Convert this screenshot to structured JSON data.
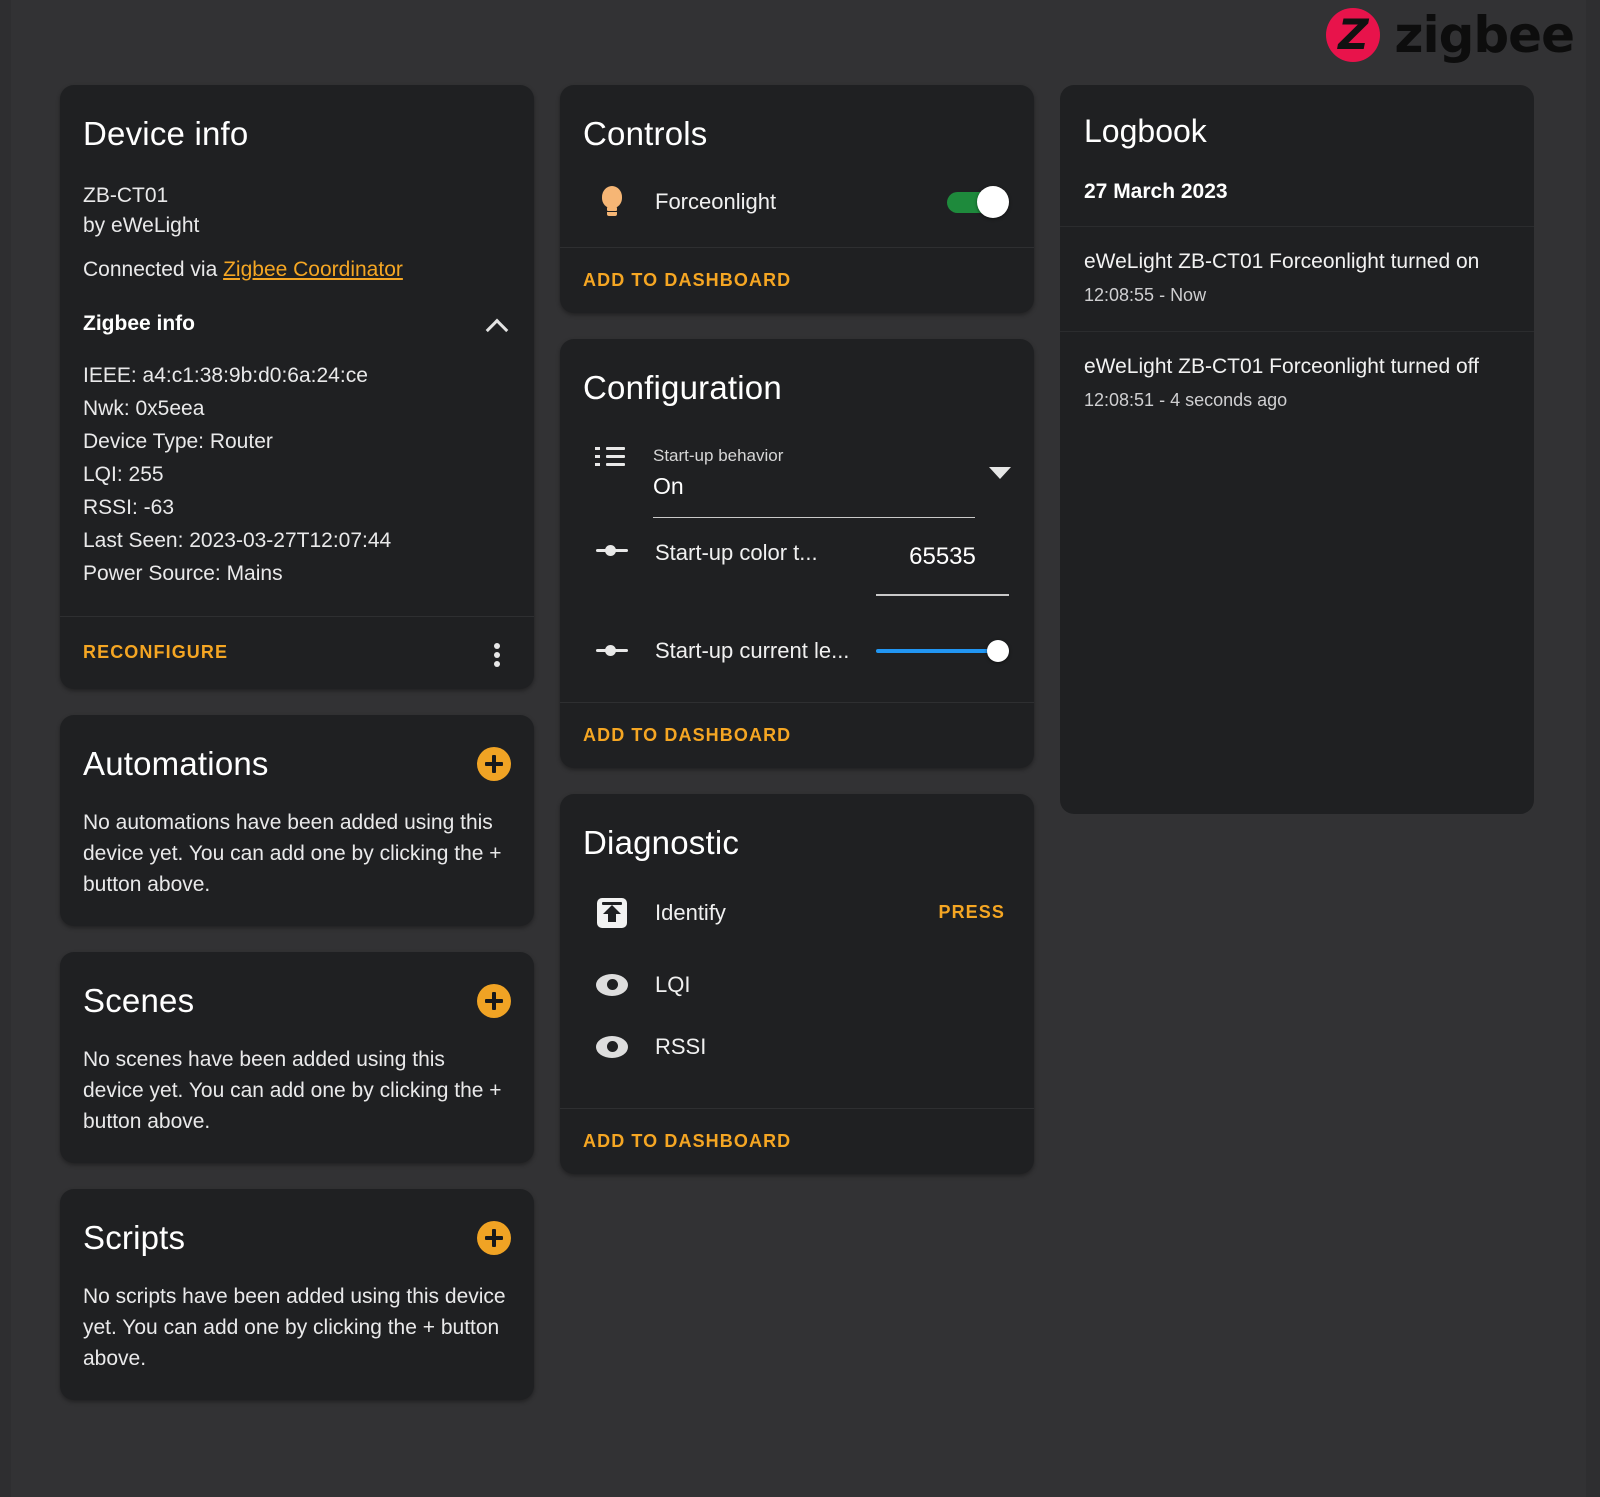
{
  "logo": {
    "mark_letter": "Z",
    "text": "zigbee",
    "mark_color": "#e8134b"
  },
  "device_info": {
    "title": "Device info",
    "model": "ZB-CT01",
    "manufacturer": "by eWeLight",
    "connected_prefix": "Connected via ",
    "connected_link": "Zigbee Coordinator",
    "zigbee_info_label": "Zigbee info",
    "zigbee_details": [
      "IEEE: a4:c1:38:9b:d0:6a:24:ce",
      "Nwk: 0x5eea",
      "Device Type: Router",
      "LQI: 255",
      "RSSI: -63",
      "Last Seen: 2023-03-27T12:07:44",
      "Power Source: Mains"
    ],
    "reconfigure_label": "RECONFIGURE"
  },
  "automations": {
    "title": "Automations",
    "empty_text": "No automations have been added using this device yet. You can add one by clicking the + button above."
  },
  "scenes": {
    "title": "Scenes",
    "empty_text": "No scenes have been added using this device yet. You can add one by clicking the + button above."
  },
  "scripts": {
    "title": "Scripts",
    "empty_text": "No scripts have been added using this device yet. You can add one by clicking the + button above."
  },
  "controls": {
    "title": "Controls",
    "entity_label": "Forceonlight",
    "toggle_state": "on",
    "toggle_color": "#1e8a3c",
    "add_to_dashboard": "ADD TO DASHBOARD"
  },
  "configuration": {
    "title": "Configuration",
    "startup_behavior_label": "Start-up behavior",
    "startup_behavior_value": "On",
    "startup_color_label": "Start-up color t...",
    "startup_color_value": "65535",
    "startup_level_label": "Start-up current le...",
    "startup_level_percent": 100,
    "slider_color": "#2196f3",
    "add_to_dashboard": "ADD TO DASHBOARD"
  },
  "diagnostic": {
    "title": "Diagnostic",
    "identify_label": "Identify",
    "identify_action": "PRESS",
    "lqi_label": "LQI",
    "rssi_label": "RSSI",
    "add_to_dashboard": "ADD TO DASHBOARD"
  },
  "logbook": {
    "title": "Logbook",
    "date": "27 March 2023",
    "entries": [
      {
        "text": "eWeLight ZB-CT01 Forceonlight turned on",
        "meta": "12:08:55 - Now"
      },
      {
        "text": "eWeLight ZB-CT01 Forceonlight turned off",
        "meta": "12:08:51 - 4 seconds ago"
      }
    ]
  },
  "accent_color": "#f5a623"
}
